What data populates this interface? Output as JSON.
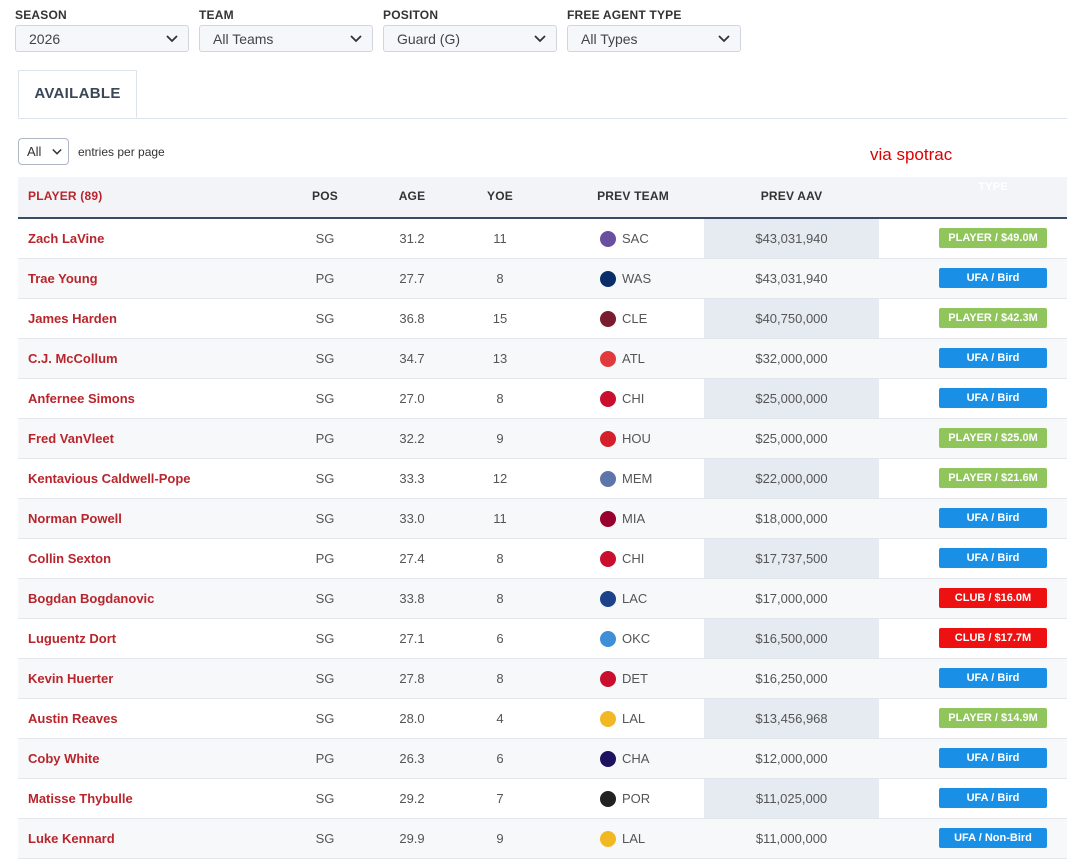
{
  "filters": [
    {
      "label": "SEASON",
      "value": "2026"
    },
    {
      "label": "TEAM",
      "value": "All Teams"
    },
    {
      "label": "POSITON",
      "value": "Guard (G)"
    },
    {
      "label": "FREE AGENT TYPE",
      "value": "All Types"
    }
  ],
  "tab": {
    "label": "AVAILABLE"
  },
  "entries": {
    "value": "All",
    "label": "entries per page"
  },
  "watermark": "via spotrac",
  "colors": {
    "player_option": "#8fc55a",
    "ufa": "#1a8fe6",
    "club_option": "#ee1111",
    "player_name": "#b8252c",
    "header_rule": "#3c4a63"
  },
  "table": {
    "headers": {
      "player": "PLAYER (89)",
      "pos": "POS",
      "age": "AGE",
      "yoe": "YOE",
      "prev_team": "PREV TEAM",
      "prev_aav": "PREV AAV",
      "type": "TYPE"
    },
    "rows": [
      {
        "player": "Zach LaVine",
        "pos": "SG",
        "age": "31.2",
        "yoe": "11",
        "team": "SAC",
        "logo_icon": "kings-logo-icon",
        "aav": "$43,031,940",
        "type": "PLAYER / $49.0M",
        "type_kind": "player"
      },
      {
        "player": "Trae Young",
        "pos": "PG",
        "age": "27.7",
        "yoe": "8",
        "team": "WAS",
        "logo_icon": "wizards-logo-icon",
        "aav": "$43,031,940",
        "type": "UFA / Bird",
        "type_kind": "ufa"
      },
      {
        "player": "James Harden",
        "pos": "SG",
        "age": "36.8",
        "yoe": "15",
        "team": "CLE",
        "logo_icon": "cavaliers-logo-icon",
        "aav": "$40,750,000",
        "type": "PLAYER / $42.3M",
        "type_kind": "player"
      },
      {
        "player": "C.J. McCollum",
        "pos": "SG",
        "age": "34.7",
        "yoe": "13",
        "team": "ATL",
        "logo_icon": "hawks-logo-icon",
        "aav": "$32,000,000",
        "type": "UFA / Bird",
        "type_kind": "ufa"
      },
      {
        "player": "Anfernee Simons",
        "pos": "SG",
        "age": "27.0",
        "yoe": "8",
        "team": "CHI",
        "logo_icon": "bulls-logo-icon",
        "aav": "$25,000,000",
        "type": "UFA / Bird",
        "type_kind": "ufa"
      },
      {
        "player": "Fred VanVleet",
        "pos": "PG",
        "age": "32.2",
        "yoe": "9",
        "team": "HOU",
        "logo_icon": "rockets-logo-icon",
        "aav": "$25,000,000",
        "type": "PLAYER / $25.0M",
        "type_kind": "player"
      },
      {
        "player": "Kentavious Caldwell-Pope",
        "pos": "SG",
        "age": "33.3",
        "yoe": "12",
        "team": "MEM",
        "logo_icon": "grizzlies-logo-icon",
        "aav": "$22,000,000",
        "type": "PLAYER / $21.6M",
        "type_kind": "player"
      },
      {
        "player": "Norman Powell",
        "pos": "SG",
        "age": "33.0",
        "yoe": "11",
        "team": "MIA",
        "logo_icon": "heat-logo-icon",
        "aav": "$18,000,000",
        "type": "UFA / Bird",
        "type_kind": "ufa"
      },
      {
        "player": "Collin Sexton",
        "pos": "PG",
        "age": "27.4",
        "yoe": "8",
        "team": "CHI",
        "logo_icon": "bulls-logo-icon",
        "aav": "$17,737,500",
        "type": "UFA / Bird",
        "type_kind": "ufa"
      },
      {
        "player": "Bogdan Bogdanovic",
        "pos": "SG",
        "age": "33.8",
        "yoe": "8",
        "team": "LAC",
        "logo_icon": "clippers-logo-icon",
        "aav": "$17,000,000",
        "type": "CLUB / $16.0M",
        "type_kind": "club"
      },
      {
        "player": "Luguentz Dort",
        "pos": "SG",
        "age": "27.1",
        "yoe": "6",
        "team": "OKC",
        "logo_icon": "thunder-logo-icon",
        "aav": "$16,500,000",
        "type": "CLUB / $17.7M",
        "type_kind": "club"
      },
      {
        "player": "Kevin Huerter",
        "pos": "SG",
        "age": "27.8",
        "yoe": "8",
        "team": "DET",
        "logo_icon": "pistons-logo-icon",
        "aav": "$16,250,000",
        "type": "UFA / Bird",
        "type_kind": "ufa"
      },
      {
        "player": "Austin Reaves",
        "pos": "SG",
        "age": "28.0",
        "yoe": "4",
        "team": "LAL",
        "logo_icon": "lakers-logo-icon",
        "aav": "$13,456,968",
        "type": "PLAYER / $14.9M",
        "type_kind": "player"
      },
      {
        "player": "Coby White",
        "pos": "PG",
        "age": "26.3",
        "yoe": "6",
        "team": "CHA",
        "logo_icon": "hornets-logo-icon",
        "aav": "$12,000,000",
        "type": "UFA / Bird",
        "type_kind": "ufa"
      },
      {
        "player": "Matisse Thybulle",
        "pos": "SG",
        "age": "29.2",
        "yoe": "7",
        "team": "POR",
        "logo_icon": "blazers-logo-icon",
        "aav": "$11,025,000",
        "type": "UFA / Bird",
        "type_kind": "ufa"
      },
      {
        "player": "Luke Kennard",
        "pos": "SG",
        "age": "29.9",
        "yoe": "9",
        "team": "LAL",
        "logo_icon": "lakers-logo-icon",
        "aav": "$11,000,000",
        "type": "UFA / Non-Bird",
        "type_kind": "ufa"
      }
    ]
  }
}
